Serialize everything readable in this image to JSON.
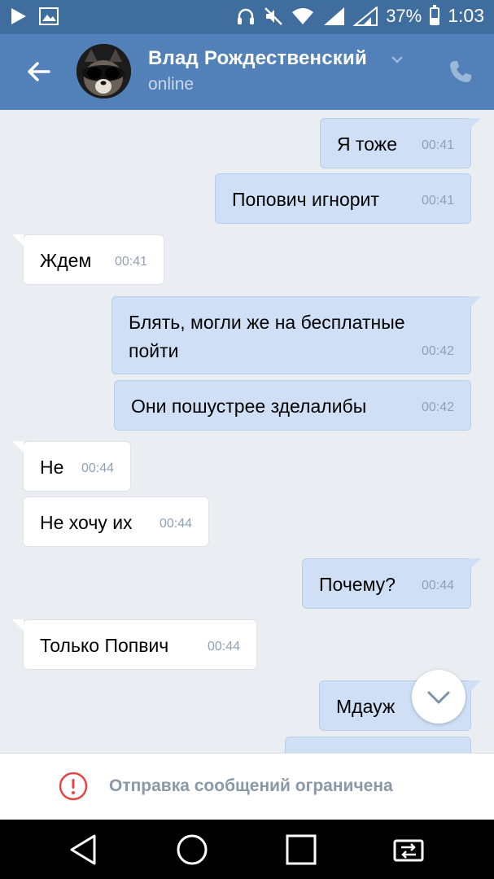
{
  "status_bar": {
    "battery_percent_text": "37%",
    "battery_level": 0.37,
    "time": "1:03",
    "icons": [
      "play-icon",
      "image-icon",
      "headphones-icon",
      "mute-icon",
      "wifi-icon",
      "signal-icon",
      "signal-icon-2",
      "battery-icon"
    ]
  },
  "header": {
    "contact_name": "Влад Рождественский",
    "status": "online",
    "accent_color": "#5181b8"
  },
  "messages": [
    {
      "dir": "out",
      "text": "Я тоже",
      "time": "00:41"
    },
    {
      "dir": "out",
      "text": "Попович игнорит",
      "time": "00:41"
    },
    {
      "dir": "in",
      "text": "Ждем",
      "time": "00:41"
    },
    {
      "dir": "out",
      "text": "Блять, могли же на бесплатные пойти",
      "time": "00:42"
    },
    {
      "dir": "out",
      "text": "Они пошустрее зделалибы",
      "time": "00:42"
    },
    {
      "dir": "in",
      "text": "Не",
      "time": "00:44"
    },
    {
      "dir": "in",
      "text": "Не хочу их",
      "time": "00:44"
    },
    {
      "dir": "out",
      "text": "Почему?",
      "time": "00:44"
    },
    {
      "dir": "in",
      "text": "Только Попвич",
      "time": "00:44"
    },
    {
      "dir": "out",
      "text": "Мдауж",
      "time": ""
    }
  ],
  "restriction": {
    "text": "Отправка сообщений ограничена"
  },
  "nav": {
    "icons": [
      "back-triangle-icon",
      "home-circle-icon",
      "recents-square-icon",
      "screen-switch-icon"
    ]
  }
}
